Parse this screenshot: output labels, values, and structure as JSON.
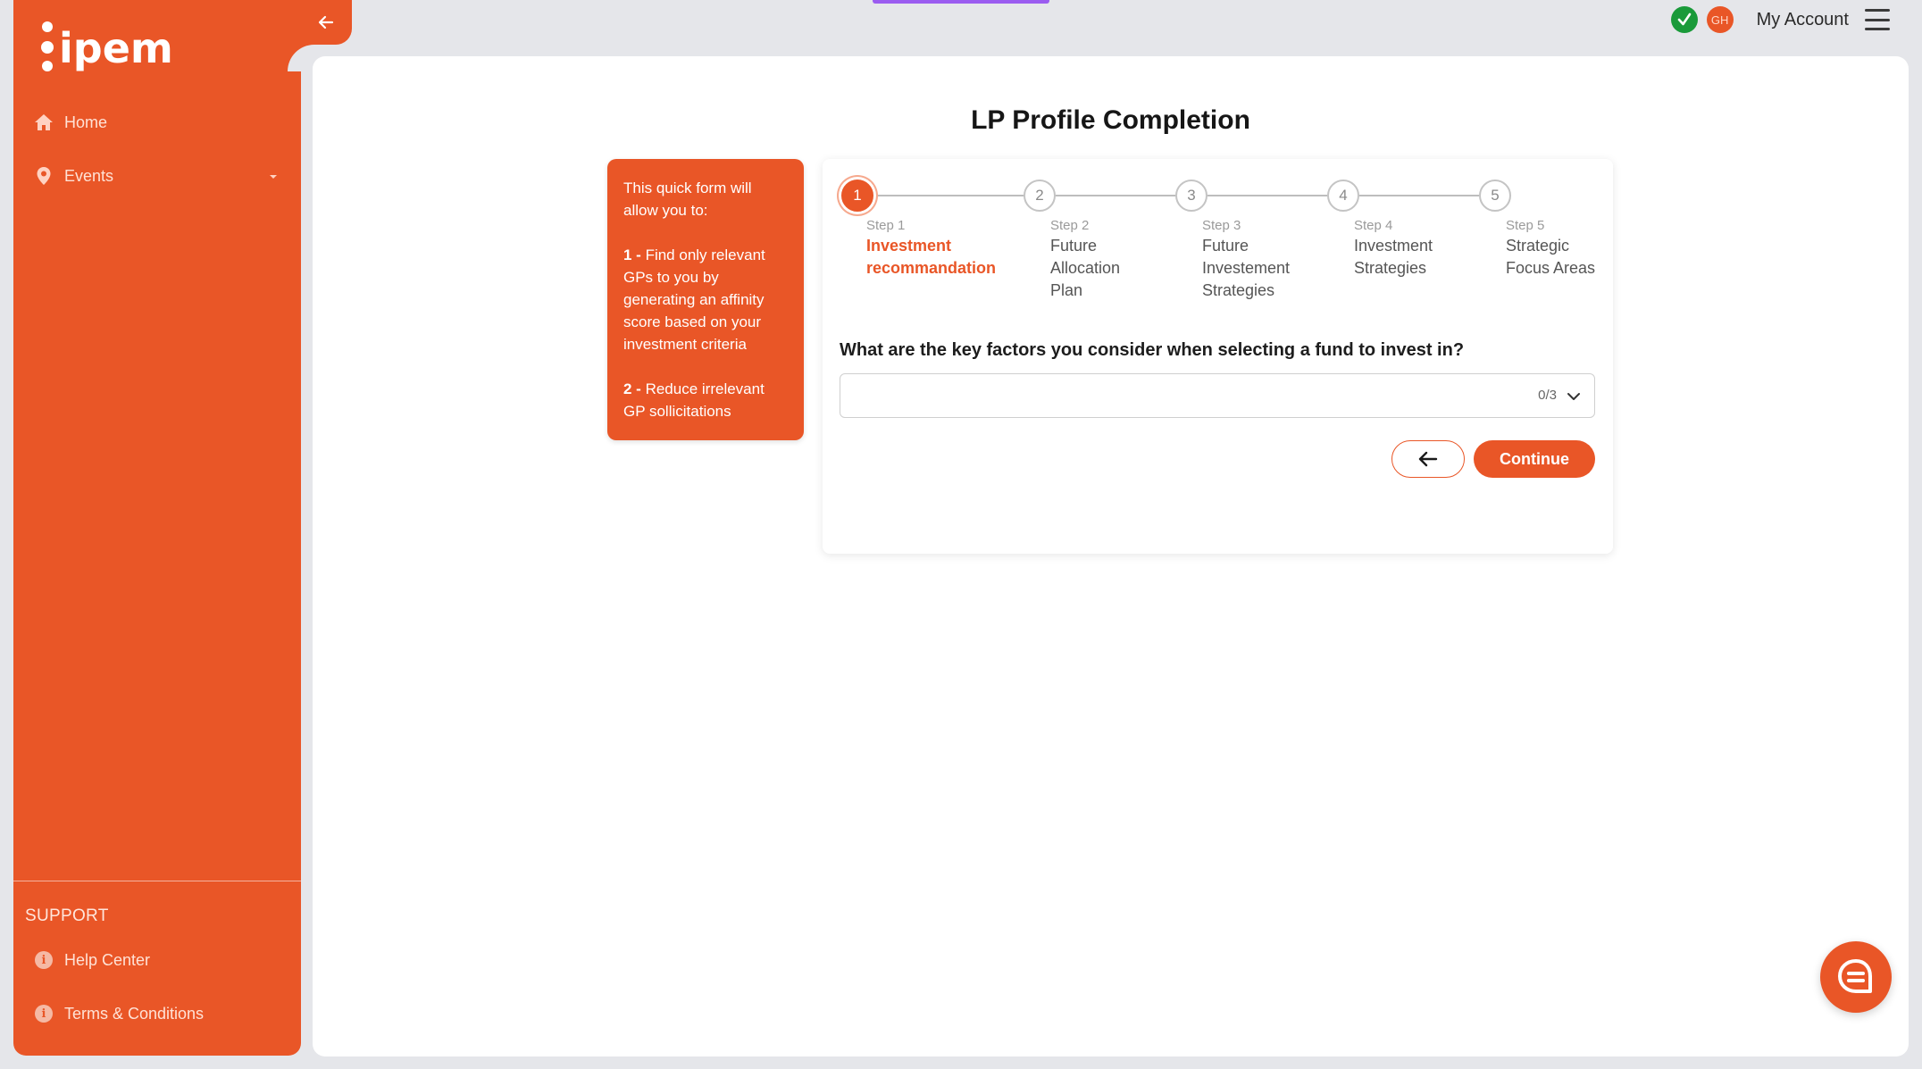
{
  "brand": {
    "logo_text": "ipem",
    "accent": "#e95627",
    "purple_bar": "#9b5cf0"
  },
  "sidebar": {
    "items": [
      {
        "label": "Home",
        "icon": "home-icon"
      },
      {
        "label": "Events",
        "icon": "location-pin-icon"
      }
    ],
    "support_label": "SUPPORT",
    "support_items": [
      {
        "label": "Help Center",
        "icon": "info-icon"
      },
      {
        "label": "Terms & Conditions",
        "icon": "info-icon"
      }
    ]
  },
  "header": {
    "avatar_initials": "GH",
    "my_account_label": "My Account"
  },
  "page": {
    "title": "LP Profile Completion"
  },
  "info_box": {
    "intro": "This quick form will allow you to:",
    "point1_num": "1 -",
    "point1_text": " Find only relevant GPs to you by generating an affinity score based on your investment criteria",
    "point2_num": "2 -",
    "point2_text": " Reduce irrelevant GP sollicitations"
  },
  "stepper": {
    "steps": [
      {
        "number": "1",
        "step_label": "Step 1",
        "title_lines": [
          "Investment",
          "recommandation"
        ],
        "active": true
      },
      {
        "number": "2",
        "step_label": "Step 2",
        "title_lines": [
          "Future",
          "Allocation",
          "Plan"
        ],
        "active": false
      },
      {
        "number": "3",
        "step_label": "Step 3",
        "title_lines": [
          "Future",
          "Investement",
          "Strategies"
        ],
        "active": false
      },
      {
        "number": "4",
        "step_label": "Step 4",
        "title_lines": [
          "Investment",
          "Strategies"
        ],
        "active": false
      },
      {
        "number": "5",
        "step_label": "Step 5",
        "title_lines": [
          "Strategic",
          "Focus Areas"
        ],
        "active": false
      }
    ]
  },
  "form": {
    "question": "What are the key factors you consider when selecting a fund to invest in?",
    "select_count": "0/3",
    "continue_label": "Continue"
  }
}
